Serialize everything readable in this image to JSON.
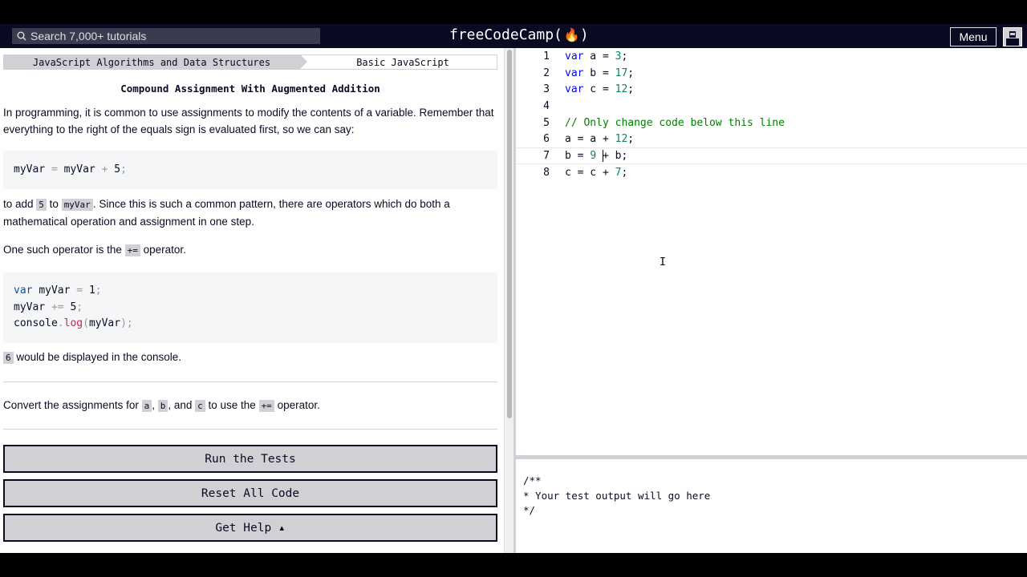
{
  "navbar": {
    "search_placeholder": "Search 7,000+ tutorials",
    "logo": "freeCodeCamp(",
    "logo_flame": "🔥",
    "logo_close": ")",
    "menu_label": "Menu"
  },
  "lesson": {
    "breadcrumb": [
      "JavaScript Algorithms and Data Structures",
      "Basic JavaScript"
    ],
    "title": "Compound Assignment With Augmented Addition",
    "p1": "In programming, it is common to use assignments to modify the contents of a variable. Remember that everything to the right of the equals sign is evaluated first, so we can say:",
    "code1": {
      "a": "myVar",
      "eq": "=",
      "b": "myVar",
      "plus": "+",
      "n": "5",
      "semi": ";"
    },
    "p2_start": "to add ",
    "p2_code1": "5",
    "p2_mid": " to ",
    "p2_code2": "myVar",
    "p2_end": ". Since this is such a common pattern, there are operators which do both a mathematical operation and assignment in one step.",
    "p3_start": "One such operator is the ",
    "p3_code": "+=",
    "p3_end": " operator.",
    "code2": {
      "l1_kw": "var",
      "l1_var": "myVar",
      "l1_eq": "=",
      "l1_n": "1",
      "l1_semi": ";",
      "l2_var": "myVar",
      "l2_op": "+=",
      "l2_n": "5",
      "l2_semi": ";",
      "l3_obj": "console",
      "l3_dot": ".",
      "l3_fn": "log",
      "l3_po": "(",
      "l3_arg": "myVar",
      "l3_pc": ");"
    },
    "p4_code": "6",
    "p4_end": " would be displayed in the console.",
    "p5_start": "Convert the assignments for ",
    "p5_a": "a",
    "p5_s1": ", ",
    "p5_b": "b",
    "p5_s2": ", and ",
    "p5_c": "c",
    "p5_s3": " to use the ",
    "p5_op": "+=",
    "p5_end": " operator."
  },
  "buttons": {
    "run": "Run the Tests",
    "reset": "Reset All Code",
    "help": "Get Help ▴"
  },
  "editor": {
    "lines": [
      {
        "n": "1",
        "kw": "var",
        "rest": " a = ",
        "num": "3",
        "end": ";"
      },
      {
        "n": "2",
        "kw": "var",
        "rest": " b = ",
        "num": "17",
        "end": ";"
      },
      {
        "n": "3",
        "kw": "var",
        "rest": " c = ",
        "num": "12",
        "end": ";"
      },
      {
        "n": "4"
      },
      {
        "n": "5",
        "comment": "// Only change code below this line"
      },
      {
        "n": "6",
        "pre": "a = a + ",
        "num": "12",
        "end": ";"
      },
      {
        "n": "7",
        "pre": "b = ",
        "num": "9",
        "mid": " ",
        "post": "+ b;"
      },
      {
        "n": "8",
        "pre": "c = c + ",
        "num": "7",
        "end": ";"
      }
    ]
  },
  "output": {
    "text": "/**\n* Your test output will go here\n*/"
  },
  "colors": {
    "navbar": "#0a0a23",
    "button_bg": "#d0d0d5",
    "keyword": "#0000ff",
    "number": "#098658",
    "comment": "#008000"
  }
}
